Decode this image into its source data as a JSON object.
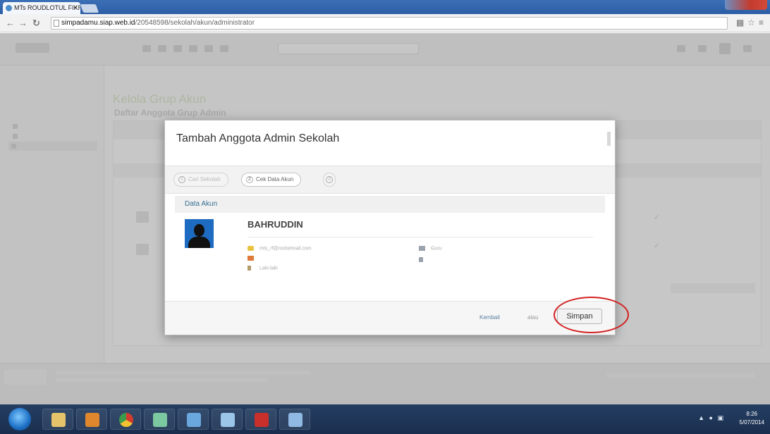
{
  "browser": {
    "tab_title": "MTs ROUDLOTUL FIKRAH",
    "tab_close": "×",
    "url_host": "simpadamu.siap.web.id",
    "url_path": "/20548598/sekolah/akun/administrator"
  },
  "background_page": {
    "title": "Kelola Grup Akun",
    "subtitle": "Daftar Anggota Grup Admin"
  },
  "modal": {
    "title": "Tambah Anggota Admin Sekolah",
    "steps": [
      {
        "num": "1",
        "label": "Cari Sekolah"
      },
      {
        "num": "2",
        "label": "Cek Data Akun"
      },
      {
        "num": "3",
        "label": ""
      }
    ],
    "section_title": "Data Akun",
    "user": {
      "name": "BAHRUDDIN",
      "email": "mts_rf@rocketmail.com",
      "gender": "Laki-laki",
      "role": "Guru"
    },
    "footer": {
      "back_label": "Kembali",
      "or_label": "atau",
      "save_label": "Simpan"
    }
  },
  "taskbar": {
    "time": "8:26",
    "date": "5/07/2014"
  },
  "annotation_color": "#d42222"
}
